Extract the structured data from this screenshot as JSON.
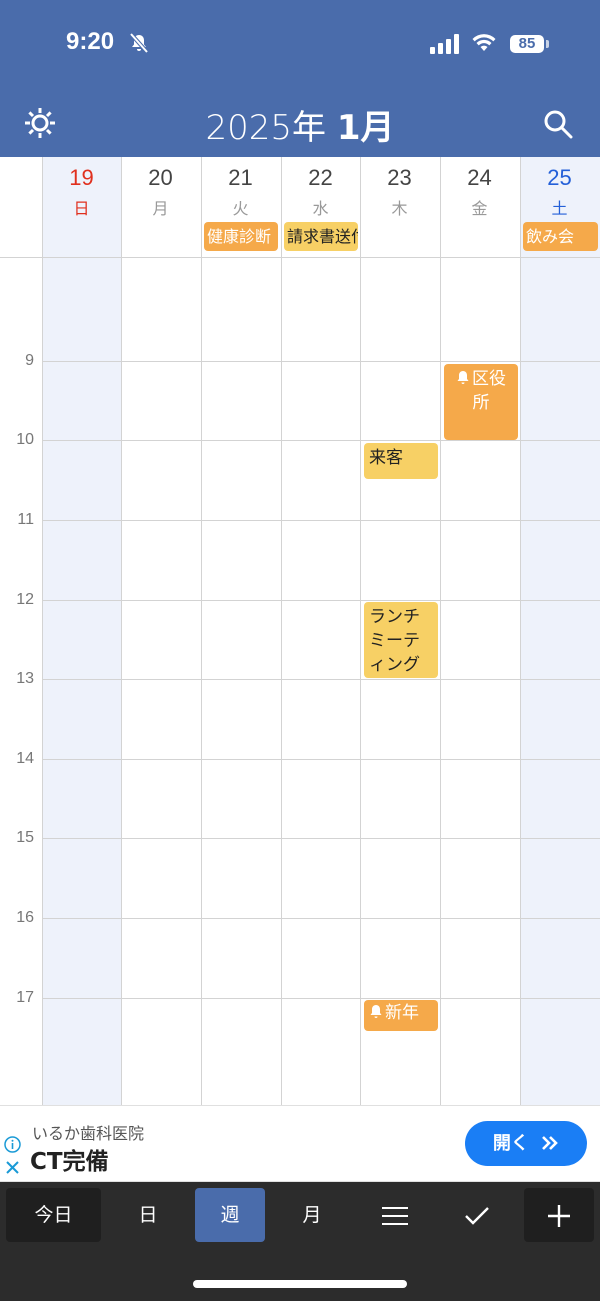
{
  "status": {
    "time": "9:20",
    "battery": "85"
  },
  "header": {
    "year": "2025",
    "year_suffix": "年",
    "month": "1月"
  },
  "days": [
    {
      "num": "19",
      "weekday": "日"
    },
    {
      "num": "20",
      "weekday": "月"
    },
    {
      "num": "21",
      "weekday": "火"
    },
    {
      "num": "22",
      "weekday": "水"
    },
    {
      "num": "23",
      "weekday": "木"
    },
    {
      "num": "24",
      "weekday": "金"
    },
    {
      "num": "25",
      "weekday": "土"
    }
  ],
  "all_day_events": [
    {
      "title": "健康診断"
    },
    {
      "title": "請求書送付"
    },
    {
      "title": "飲み会"
    }
  ],
  "hours": [
    "9",
    "10",
    "11",
    "12",
    "13",
    "14",
    "15",
    "16",
    "17"
  ],
  "events": [
    {
      "title": "区役所"
    },
    {
      "title": "来客"
    },
    {
      "title": "ランチミーティング"
    },
    {
      "title": "新年"
    }
  ],
  "ad": {
    "advertiser": "いるか歯科医院",
    "headline": "CT完備",
    "button_label": "開く"
  },
  "toolbar": {
    "today": "今日",
    "day": "日",
    "week": "週",
    "month": "月"
  },
  "colors": {
    "header_bg": "#4a6cab",
    "sunday": "#e0301e",
    "saturday": "#2460d8",
    "weekend_col": "#eef2fb",
    "event_orange": "#f5a94a",
    "event_yellow": "#f7d065",
    "toolbar_bg": "#2c2c2c",
    "toolbar_active": "#4a6cab",
    "ad_button": "#1a7ef5"
  }
}
